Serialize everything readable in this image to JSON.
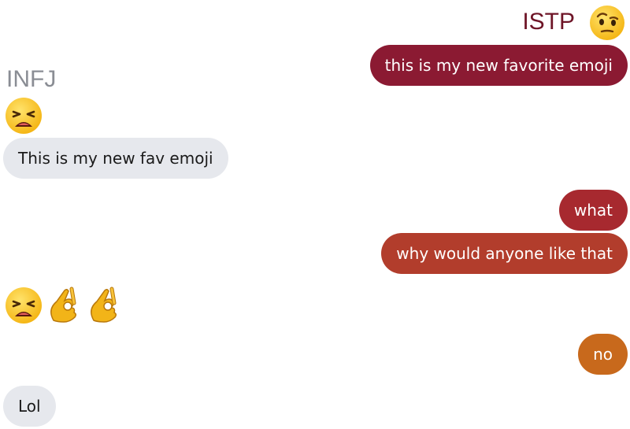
{
  "right_user": {
    "name": "ISTP",
    "emoji": "face-with-raised-eyebrow-icon",
    "name_color": "#6e1527"
  },
  "left_user": {
    "name": "INFJ",
    "emoji": "weary-face-icon",
    "name_color": "#8a8d94"
  },
  "messages": [
    {
      "side": "right",
      "text": "this is my new favorite emoji",
      "color": "#8b1a32"
    },
    {
      "side": "left",
      "text": "This is my new fav emoji"
    },
    {
      "side": "right",
      "text": "what",
      "color": "#a7292f"
    },
    {
      "side": "right",
      "text": "why would anyone like that",
      "color": "#b23d2c"
    },
    {
      "side": "left",
      "emojis": [
        "weary-face-icon",
        "ok-hand-icon",
        "ok-hand-icon"
      ]
    },
    {
      "side": "right",
      "text": "no",
      "color": "#c8691c"
    },
    {
      "side": "left",
      "text": "Lol"
    }
  ],
  "colors": {
    "incoming_bubble": "#e6e8ed",
    "background": "#ffffff"
  }
}
